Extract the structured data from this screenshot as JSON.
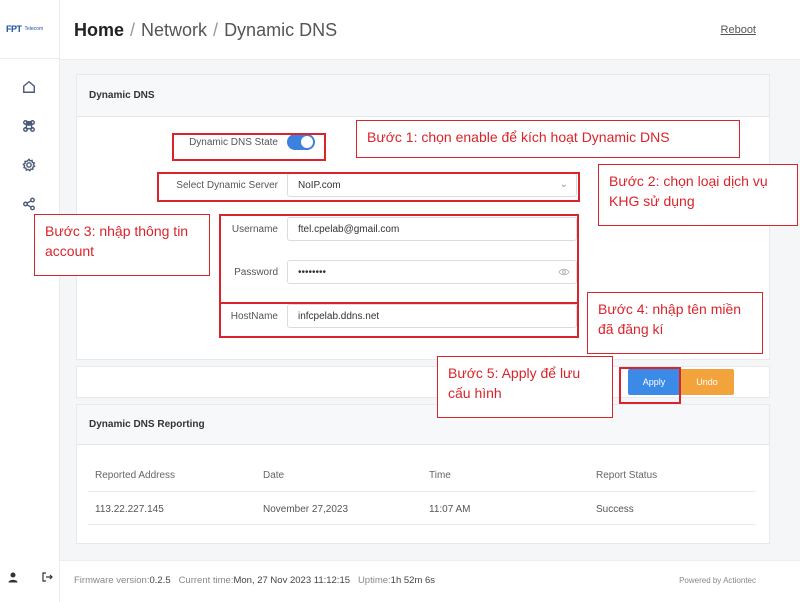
{
  "logo": {
    "mark_a": "FPT",
    "text": "Telecom"
  },
  "breadcrumb": {
    "home": "Home",
    "sep1": "/",
    "network": "Network",
    "sep2": "/",
    "current": "Dynamic DNS"
  },
  "header": {
    "reboot_label": "Reboot"
  },
  "sidebar": {
    "items": [
      {
        "icon": "home-icon"
      },
      {
        "icon": "command-icon"
      },
      {
        "icon": "gear-icon"
      },
      {
        "icon": "share-icon"
      }
    ]
  },
  "ddns": {
    "title": "Dynamic DNS",
    "state_label": "Dynamic DNS State",
    "state_enabled": true,
    "server_label": "Select Dynamic Server",
    "server_value": "NoIP.com",
    "username_label": "Username",
    "username_value": "ftel.cpelab@gmail.com",
    "password_label": "Password",
    "password_value": "••••••••",
    "hostname_label": "HostName",
    "hostname_value": "infcpelab.ddns.net"
  },
  "actions": {
    "apply_label": "Apply",
    "undo_label": "Undo"
  },
  "reporting": {
    "title": "Dynamic DNS Reporting",
    "columns": [
      "Reported Address",
      "Date",
      "Time",
      "Report Status"
    ],
    "rows": [
      [
        "113.22.227.145",
        "November 27,2023",
        "11:07 AM",
        "Success"
      ]
    ]
  },
  "footer": {
    "firmware_label": "Firmware version:",
    "firmware_value": "0.2.5",
    "time_label": "Current time:",
    "time_value": "Mon, 27 Nov 2023 11:12:15",
    "uptime_label": "Uptime:",
    "uptime_value": "1h 52m 6s",
    "powered": "Powered by Actiontec"
  },
  "notes": {
    "step1": "Bước 1: chọn enable để kích hoạt Dynamic DNS",
    "step2": "Bước 2: chọn loại dịch vụ KHG sử dụng",
    "step3": "Bước 3: nhập thông tin account",
    "step4": "Bước 4: nhập tên miền đã đăng kí",
    "step5": "Bước 5: Apply để lưu cấu hình"
  },
  "colors": {
    "accent": "#3b8ae8",
    "undo": "#f2a33c",
    "annotation": "#d9242b"
  }
}
